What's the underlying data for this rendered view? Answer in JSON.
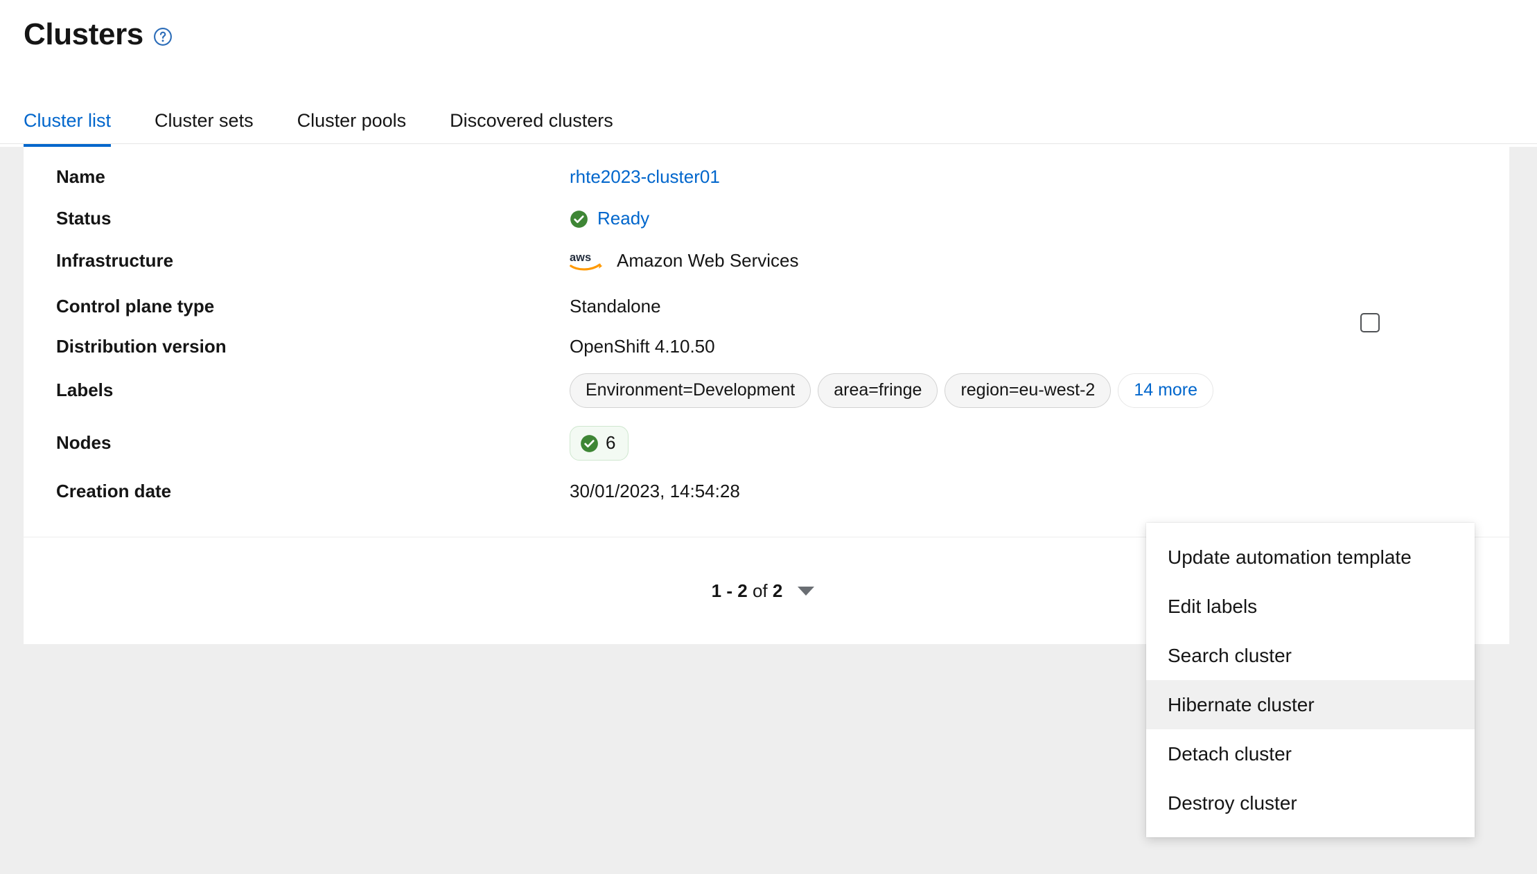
{
  "header": {
    "title": "Clusters",
    "help_icon": "help-circle-icon"
  },
  "tabs": [
    {
      "label": "Cluster list",
      "active": true
    },
    {
      "label": "Cluster sets",
      "active": false
    },
    {
      "label": "Cluster pools",
      "active": false
    },
    {
      "label": "Discovered clusters",
      "active": false
    }
  ],
  "cluster": {
    "rows": [
      {
        "key": "Name",
        "value": "rhte2023-cluster01"
      },
      {
        "key": "Status",
        "value": "Ready"
      },
      {
        "key": "Infrastructure",
        "value": "Amazon Web Services"
      },
      {
        "key": "Control plane type",
        "value": "Standalone"
      },
      {
        "key": "Distribution version",
        "value": "OpenShift 4.10.50"
      },
      {
        "key": "Labels",
        "value": ""
      },
      {
        "key": "Nodes",
        "value": "6"
      },
      {
        "key": "Creation date",
        "value": "30/01/2023, 14:54:28"
      }
    ],
    "labels": [
      "Environment=Development",
      "area=fringe",
      "region=eu-west-2"
    ],
    "labels_more": "14 more",
    "nodes_count": "6",
    "status_icon": "check-circle-icon",
    "infrastructure_icon": "aws-logo-icon",
    "kebab_icon": "kebab-menu-icon",
    "checkbox_icon": "row-checkbox"
  },
  "pagination": {
    "range": "1 - 2",
    "of_label": "of",
    "total": "2",
    "caret_icon": "chevron-down-icon"
  },
  "dropdown": {
    "items": [
      {
        "label": "Update automation template",
        "highlight": false
      },
      {
        "label": "Edit labels",
        "highlight": false
      },
      {
        "label": "Search cluster",
        "highlight": false
      },
      {
        "label": "Hibernate cluster",
        "highlight": true
      },
      {
        "label": "Detach cluster",
        "highlight": false
      },
      {
        "label": "Destroy cluster",
        "highlight": false
      }
    ]
  },
  "colors": {
    "accent_blue": "#0066cc",
    "status_green": "#3e8635",
    "aws_orange": "#ff9900",
    "page_bg": "#eeeeee",
    "card_bg": "#ffffff"
  }
}
